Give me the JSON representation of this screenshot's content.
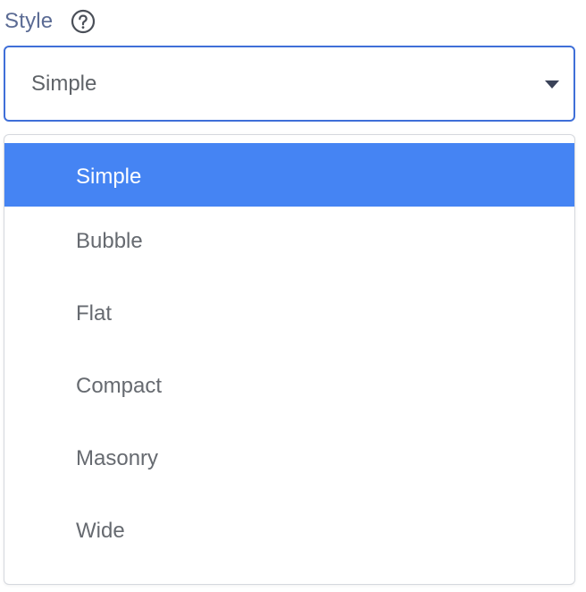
{
  "field": {
    "label": "Style",
    "help_icon": "help-circle-icon"
  },
  "select": {
    "value": "Simple",
    "caret_icon": "caret-down-icon",
    "accent_color": "#3f6fd8"
  },
  "dropdown": {
    "highlight_color": "#4584f3",
    "options": [
      {
        "label": "Simple",
        "selected": true
      },
      {
        "label": "Bubble",
        "selected": false
      },
      {
        "label": "Flat",
        "selected": false
      },
      {
        "label": "Compact",
        "selected": false
      },
      {
        "label": "Masonry",
        "selected": false
      },
      {
        "label": "Wide",
        "selected": false
      }
    ]
  }
}
